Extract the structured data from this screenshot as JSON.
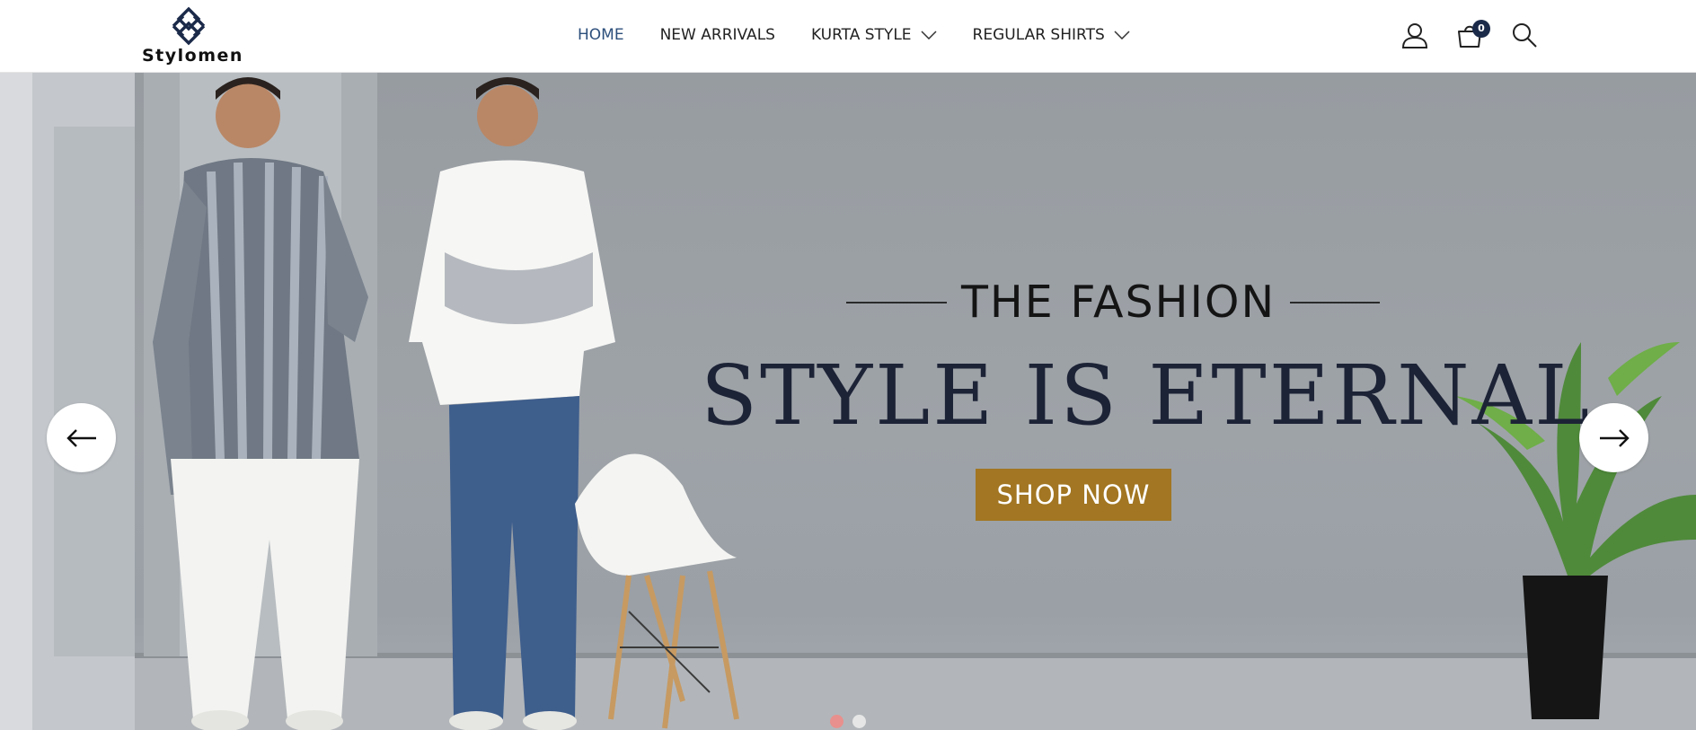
{
  "header": {
    "logo": {
      "name": "Stylomen",
      "icon": "logo-knot-icon"
    },
    "nav": [
      {
        "label": "HOME",
        "active": true
      },
      {
        "label": "NEW ARRIVALS",
        "active": false
      },
      {
        "label": "KURTA STYLE",
        "active": false,
        "dropdown": true
      },
      {
        "label": "REGULAR SHIRTS",
        "active": false,
        "dropdown": true
      }
    ],
    "icons": {
      "account": "user-icon",
      "cart": "cart-icon",
      "search": "search-icon"
    },
    "cart_count": "0"
  },
  "hero": {
    "kicker": "THE FASHION",
    "headline": "STYLE IS ETERNAL",
    "cta_label": "SHOP NOW",
    "prev_icon": "arrow-left-icon",
    "next_icon": "arrow-right-icon",
    "slides": [
      {
        "active": true
      },
      {
        "active": false
      }
    ]
  },
  "colors": {
    "nav_active": "#2d4f7c",
    "cart_badge": "#1b2a49",
    "cta_background": "#a27622",
    "headline": "#1d2336",
    "dot_active": "#e8908d",
    "dot_inactive": "#e6e6e6"
  }
}
